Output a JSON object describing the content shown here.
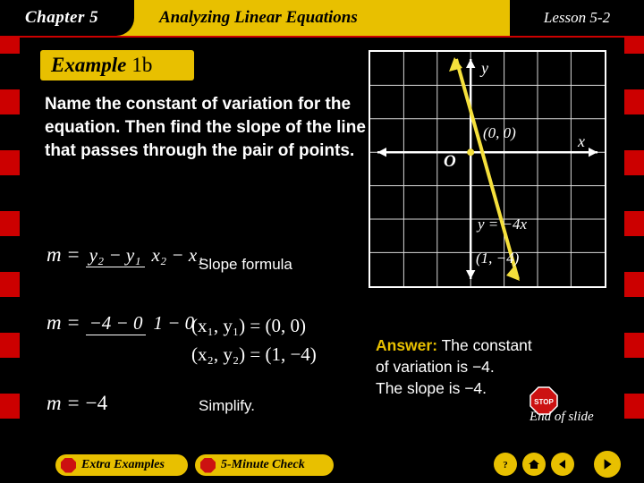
{
  "header": {
    "chapter": "Chapter 5",
    "title": "Analyzing Linear Equations",
    "lesson": "Lesson 5-2"
  },
  "example": {
    "word": "Example",
    "number": "1b"
  },
  "prompt": "Name the constant of variation for the equation. Then find the slope of the line that passes through the pair of points.",
  "work": {
    "line1": {
      "m": "m",
      "eq": "=",
      "num": "y₂ − y₁",
      "den": "x₂ − x₁",
      "label": "Slope formula"
    },
    "line2": {
      "m": "m",
      "eq": "=",
      "num": "−4 − 0",
      "den": "1 − 0",
      "points1": "(x₁, y₁) = (0, 0)",
      "points2": "(x₂, y₂) = (1, −4)"
    },
    "line3": {
      "m": "m",
      "eq": "=",
      "value": "−4",
      "label": "Simplify."
    }
  },
  "graph": {
    "x_axis_label": "x",
    "y_axis_label": "y",
    "origin_label": "O",
    "point1_label": "(0, 0)",
    "point2_label": "(1, −4)",
    "equation_label": "y = −4x",
    "line_color": "#f5e03c"
  },
  "answer": {
    "word": "Answer:",
    "text_line1": "The constant",
    "text_line2": "of variation is −4.",
    "text_line3": "The slope is −4."
  },
  "end_of_slide": "End of slide",
  "stop_label": "STOP",
  "footer": {
    "extra_examples": "Extra Examples",
    "five_minute_check": "5-Minute Check",
    "help_icon": "question-mark-icon",
    "home_icon": "home-icon",
    "prev_icon": "previous-arrow-icon",
    "next_icon": "next-arrow-icon"
  },
  "colors": {
    "frame": "#cc0000",
    "accent": "#e8c000",
    "background": "#000000"
  }
}
